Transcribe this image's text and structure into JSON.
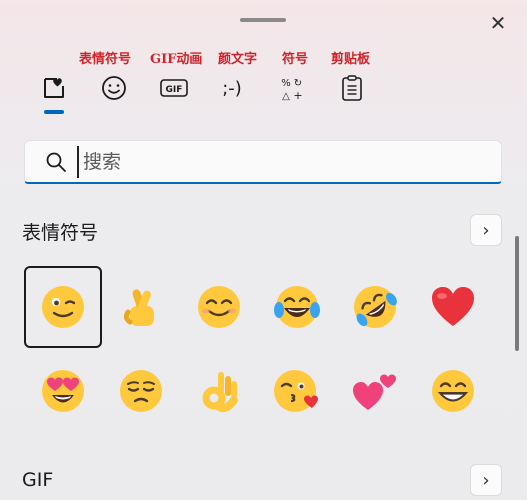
{
  "tab_labels": [
    "表情符号",
    "GIF动画",
    "颜文字",
    "符号",
    "剪贴板"
  ],
  "tabs": [
    {
      "name": "emoji",
      "icon": "heart-sticker-icon",
      "active": true
    },
    {
      "name": "gif",
      "icon": "gif-icon",
      "gif_text": "GIF"
    },
    {
      "name": "kaomoji",
      "icon": "kaomoji-icon",
      "kaomoji_text": ";-)"
    },
    {
      "name": "symbols",
      "icon": "symbols-icon"
    },
    {
      "name": "clipboard",
      "icon": "clipboard-icon"
    }
  ],
  "search": {
    "placeholder": "搜索",
    "value": ""
  },
  "close_glyph": "✕",
  "sections": [
    {
      "title": "表情符号",
      "more_glyph": "›"
    },
    {
      "title": "GIF",
      "more_glyph": "›"
    }
  ],
  "emoji": [
    {
      "name": "winking-face",
      "selected": true
    },
    {
      "name": "crossed-fingers"
    },
    {
      "name": "smiling-face-with-smiling-eyes"
    },
    {
      "name": "face-with-tears-of-joy"
    },
    {
      "name": "rolling-on-the-floor-laughing"
    },
    {
      "name": "red-heart"
    },
    {
      "name": "smiling-face-with-heart-eyes"
    },
    {
      "name": "relieved-face"
    },
    {
      "name": "ok-hand"
    },
    {
      "name": "face-blowing-a-kiss"
    },
    {
      "name": "two-hearts"
    },
    {
      "name": "beaming-face-with-smiling-eyes"
    }
  ],
  "colors": {
    "accent": "#0067c0",
    "label_red": "#d0242a",
    "emoji_yellow": "#ffc83d",
    "heart_red": "#e8323c",
    "heart_pink": "#f0427a"
  }
}
